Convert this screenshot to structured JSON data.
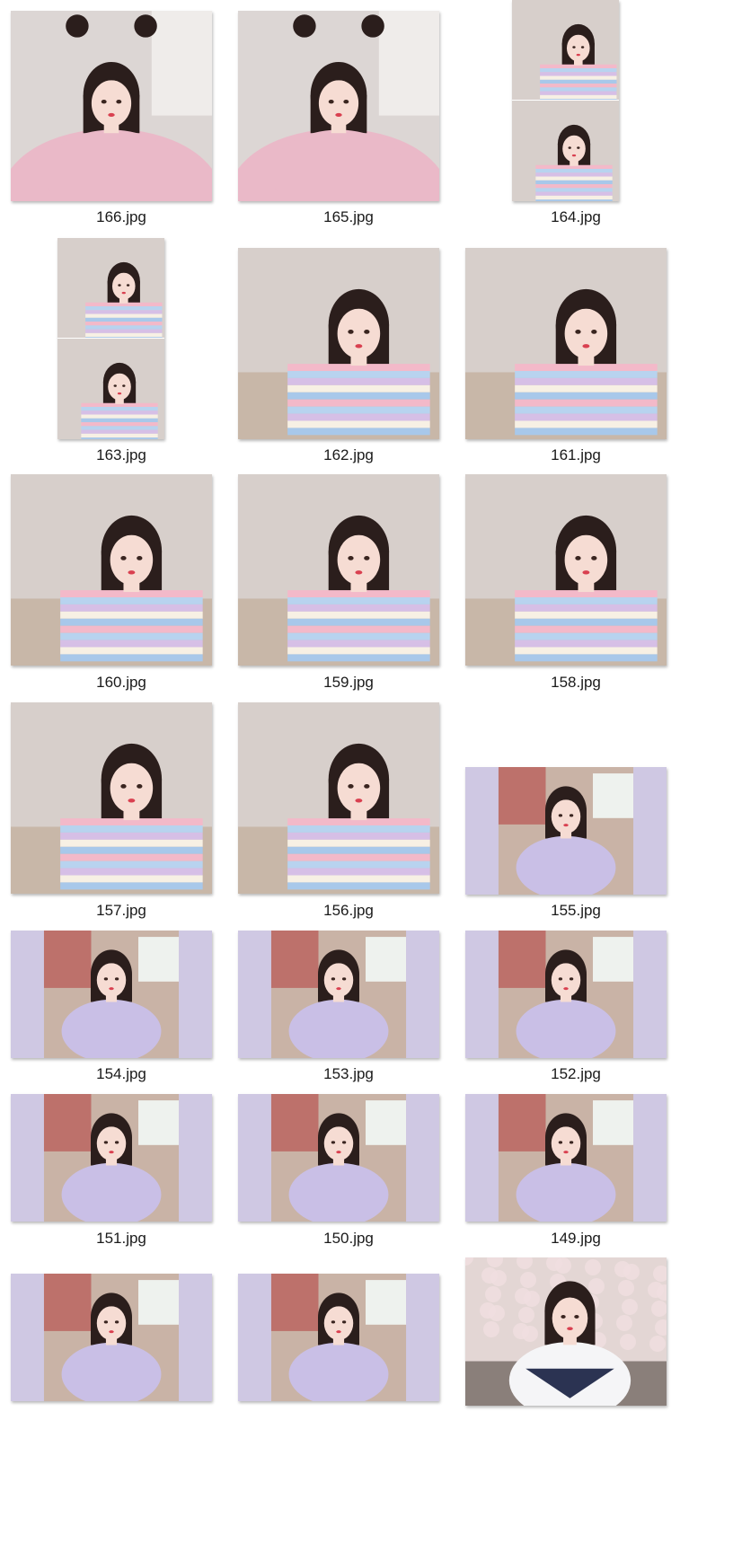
{
  "window": {
    "view": "large-icons"
  },
  "files": [
    {
      "name": "166.jpg",
      "kind": "pink-dress",
      "orientation": "landscape"
    },
    {
      "name": "165.jpg",
      "kind": "pink-dress",
      "orientation": "landscape"
    },
    {
      "name": "164.jpg",
      "kind": "stripe-collage",
      "orientation": "portrait"
    },
    {
      "name": "163.jpg",
      "kind": "stripe-collage",
      "orientation": "portrait"
    },
    {
      "name": "162.jpg",
      "kind": "stripe",
      "orientation": "landscape"
    },
    {
      "name": "161.jpg",
      "kind": "stripe",
      "orientation": "landscape"
    },
    {
      "name": "160.jpg",
      "kind": "stripe",
      "orientation": "landscape"
    },
    {
      "name": "159.jpg",
      "kind": "stripe",
      "orientation": "landscape"
    },
    {
      "name": "158.jpg",
      "kind": "stripe",
      "orientation": "landscape"
    },
    {
      "name": "157.jpg",
      "kind": "stripe",
      "orientation": "landscape"
    },
    {
      "name": "156.jpg",
      "kind": "stripe",
      "orientation": "landscape"
    },
    {
      "name": "155.jpg",
      "kind": "lavender-car",
      "orientation": "wide"
    },
    {
      "name": "154.jpg",
      "kind": "lavender-car",
      "orientation": "wide"
    },
    {
      "name": "153.jpg",
      "kind": "lavender-car",
      "orientation": "wide"
    },
    {
      "name": "152.jpg",
      "kind": "lavender-car",
      "orientation": "wide"
    },
    {
      "name": "151.jpg",
      "kind": "lavender-car",
      "orientation": "wide"
    },
    {
      "name": "150.jpg",
      "kind": "lavender-car",
      "orientation": "wide"
    },
    {
      "name": "149.jpg",
      "kind": "lavender-car",
      "orientation": "wide"
    },
    {
      "name": "",
      "kind": "lavender-car",
      "orientation": "wide"
    },
    {
      "name": "",
      "kind": "lavender-car",
      "orientation": "wide"
    },
    {
      "name": "",
      "kind": "blossom-sailor",
      "orientation": "landscape"
    }
  ],
  "palette": {
    "label_text": "#1a1a1a",
    "stripe_colors": [
      "#f3b9c9",
      "#b8d3ef",
      "#d6bfe6",
      "#f7f0e4",
      "#a8c8ea"
    ],
    "pink_dress": "#eab9c8",
    "lavender_band": "#cfc8e3",
    "lavender_shirt": "#c9bfe6",
    "hair": "#2b1e1c",
    "skin": "#f6dcd3"
  }
}
